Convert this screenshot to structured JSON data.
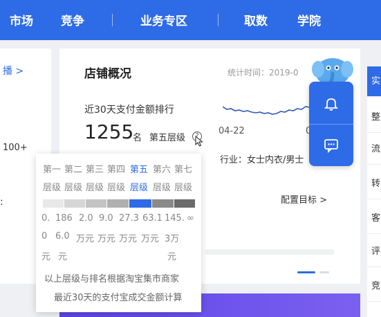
{
  "nav": {
    "items": [
      "市场",
      "竞争",
      "业务专区",
      "取数",
      "学院"
    ]
  },
  "left_card": {
    "link": "播 >",
    "number": "100+",
    "colon": ":"
  },
  "shop_overview": {
    "title": "店铺概况",
    "stat_time": "统计时间：2019-0",
    "rank_title": "近30天支付金额排行",
    "rank_value": "1255",
    "rank_unit": "名",
    "tier_label": "第五层级",
    "help_icon": "?",
    "trend_date": "04-22",
    "trend_date2": "0",
    "industry": "行业：女士内衣/男士",
    "config_target": "配置目标 >"
  },
  "tooltip": {
    "tiers_line1": [
      "第一",
      "第二",
      "第三",
      "第四",
      "第五",
      "第六",
      "第七"
    ],
    "tiers_line2": [
      "层级",
      "层级",
      "层级",
      "层级",
      "层级",
      "层级",
      "层级"
    ],
    "bar_colors": [
      "#e8e8e8",
      "#d6d6d6",
      "#c4c4c4",
      "#b0b0b0",
      "#2e6be6",
      "#8a8a8a",
      "#6b6b6b"
    ],
    "highlight_index": 4,
    "values_line1": [
      "0.",
      "186",
      "2.0",
      "9.0",
      "27.3",
      "63.1",
      "145.",
      "∞"
    ],
    "values_line2": [
      "0",
      "6.0",
      "万元",
      "万元",
      "万元",
      "万元",
      "3万"
    ],
    "values_line3": [
      "元",
      "元",
      "元"
    ],
    "footnote1": "以上层级与排名根据淘宝集市商家",
    "footnote2": "最近30天的支付宝成交金额计算"
  },
  "right_tabs": [
    "实",
    "整",
    "流",
    "转",
    "客",
    "评",
    "竞"
  ],
  "float_widget": {
    "icons": [
      "bell-icon",
      "chat-icon"
    ]
  }
}
